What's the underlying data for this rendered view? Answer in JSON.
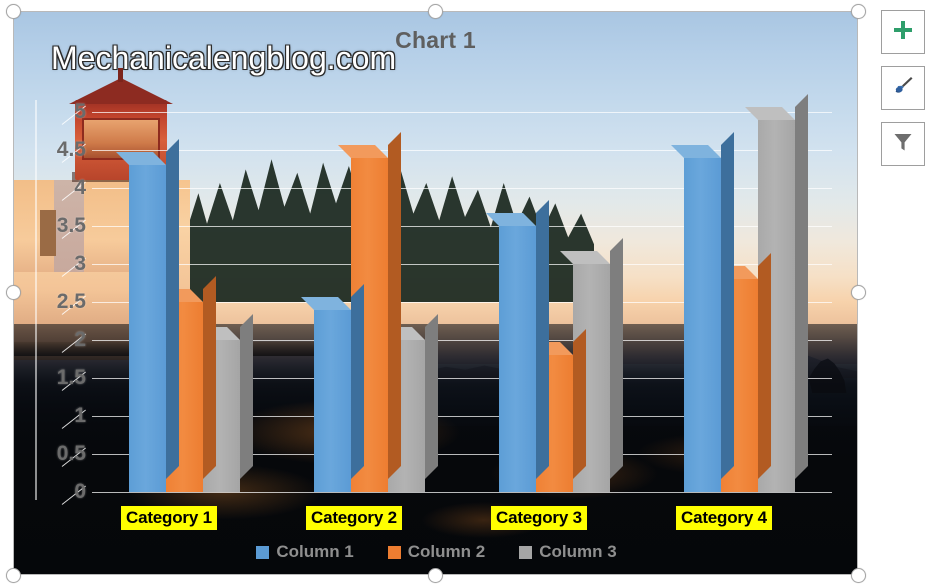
{
  "chart": {
    "title": "Chart 1",
    "watermark": "Mechanicalengblog.com"
  },
  "chart_data": {
    "type": "bar",
    "title": "Chart 1",
    "xlabel": "",
    "ylabel": "",
    "ylim": [
      0,
      5
    ],
    "ytick_labels": [
      "5",
      "4.5",
      "4",
      "3.5",
      "3",
      "2.5",
      "2",
      "1.5",
      "1",
      "0.5",
      "0"
    ],
    "ytick_values": [
      5,
      4.5,
      4,
      3.5,
      3,
      2.5,
      2,
      1.5,
      1,
      0.5,
      0
    ],
    "grid": true,
    "legend_position": "bottom",
    "three_d": true,
    "categories": [
      "Category 1",
      "Category 2",
      "Category 3",
      "Category 4"
    ],
    "series": [
      {
        "name": "Column 1",
        "color": "#5B9BD5",
        "values": [
          4.3,
          2.4,
          3.5,
          4.4
        ]
      },
      {
        "name": "Column 2",
        "color": "#ED7D31",
        "values": [
          2.5,
          4.4,
          1.8,
          2.8
        ]
      },
      {
        "name": "Column 3",
        "color": "#A5A5A5",
        "values": [
          2.0,
          2.0,
          3.0,
          4.9
        ]
      }
    ]
  },
  "quick_buttons": [
    {
      "name": "chart-elements",
      "icon": "plus-icon",
      "color": "#2e9e6b"
    },
    {
      "name": "chart-styles",
      "icon": "paintbrush-icon",
      "color": "#3b6fae"
    },
    {
      "name": "chart-filters",
      "icon": "funnel-icon",
      "color": "#6b6b6b"
    }
  ],
  "selection_handles": [
    "top-left",
    "top-center",
    "top-right",
    "middle-left",
    "middle-right",
    "bottom-left",
    "bottom-center",
    "bottom-right"
  ]
}
